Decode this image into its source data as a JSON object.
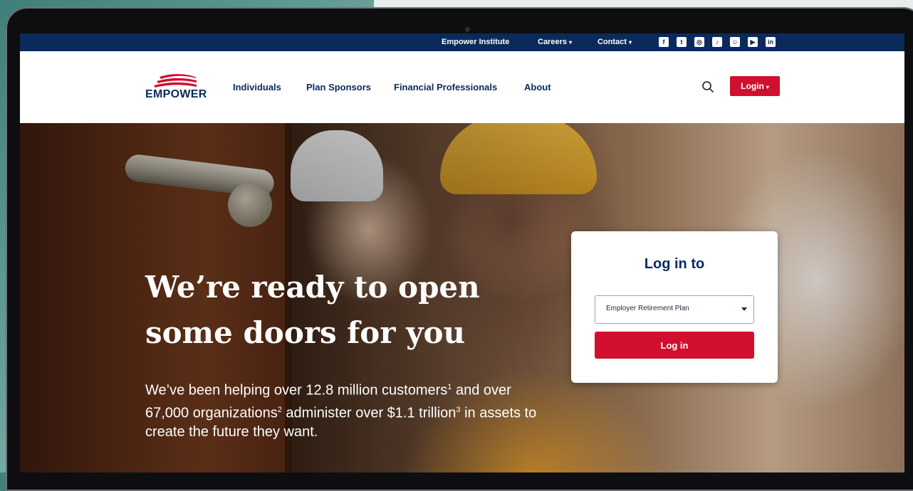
{
  "utility_bar": {
    "institute": "Empower Institute",
    "careers": "Careers",
    "contact": "Contact",
    "social": [
      {
        "icon": "facebook-icon",
        "glyph": "f"
      },
      {
        "icon": "twitter-icon",
        "glyph": "t"
      },
      {
        "icon": "instagram-icon",
        "glyph": "◎"
      },
      {
        "icon": "tiktok-icon",
        "glyph": "♪"
      },
      {
        "icon": "snapchat-icon",
        "glyph": "☺"
      },
      {
        "icon": "youtube-icon",
        "glyph": "▶"
      },
      {
        "icon": "linkedin-icon",
        "glyph": "in"
      }
    ]
  },
  "header": {
    "logo_text": "EMPOWER",
    "nav": [
      "Individuals",
      "Plan Sponsors",
      "Financial Professionals",
      "About"
    ],
    "login_label": "Login"
  },
  "hero": {
    "headline": "We’re ready to open some doors for you",
    "body": {
      "part1": "We’ve been helping over 12.8 million customers",
      "sup1": "1",
      "part2": " and over 67,000 organizations",
      "sup2": "2",
      "part3": " administer over $1.1 trillion",
      "sup3": "3",
      "part4": " in assets to create the future they want."
    }
  },
  "login_card": {
    "title": "Log in to",
    "select_value": "Employer Retirement Plan",
    "button_label": "Log in"
  },
  "colors": {
    "navy": "#0a2a5c",
    "red": "#d0102e",
    "white": "#ffffff"
  }
}
